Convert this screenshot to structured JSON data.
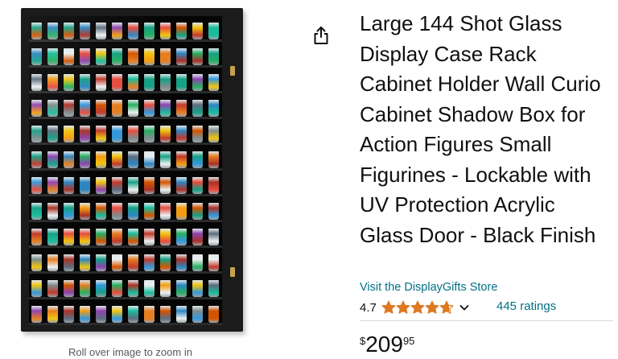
{
  "product": {
    "title": "Large 144 Shot Glass Display Case Rack Cabinet Holder Wall Curio Cabinet Shadow Box for Action Figures Small Figurines - Lockable with UV Protection Acrylic Glass Door - Black Finish",
    "store_link": "Visit the DisplayGifts Store",
    "rating_value": "4.7",
    "rating_stars": 4.7,
    "ratings_count": "445 ratings",
    "price": {
      "symbol": "$",
      "whole": "209",
      "fraction": "95"
    }
  },
  "image": {
    "zoom_hint": "Roll over image to zoom in",
    "shelf_rows": 12,
    "glasses_per_row": 12
  },
  "icons": {
    "share": "share-icon",
    "star": "star-icon",
    "chevron": "chevron-down-icon"
  },
  "colors": {
    "link": "#007185",
    "star": "#DE7921",
    "text": "#0F1111"
  }
}
